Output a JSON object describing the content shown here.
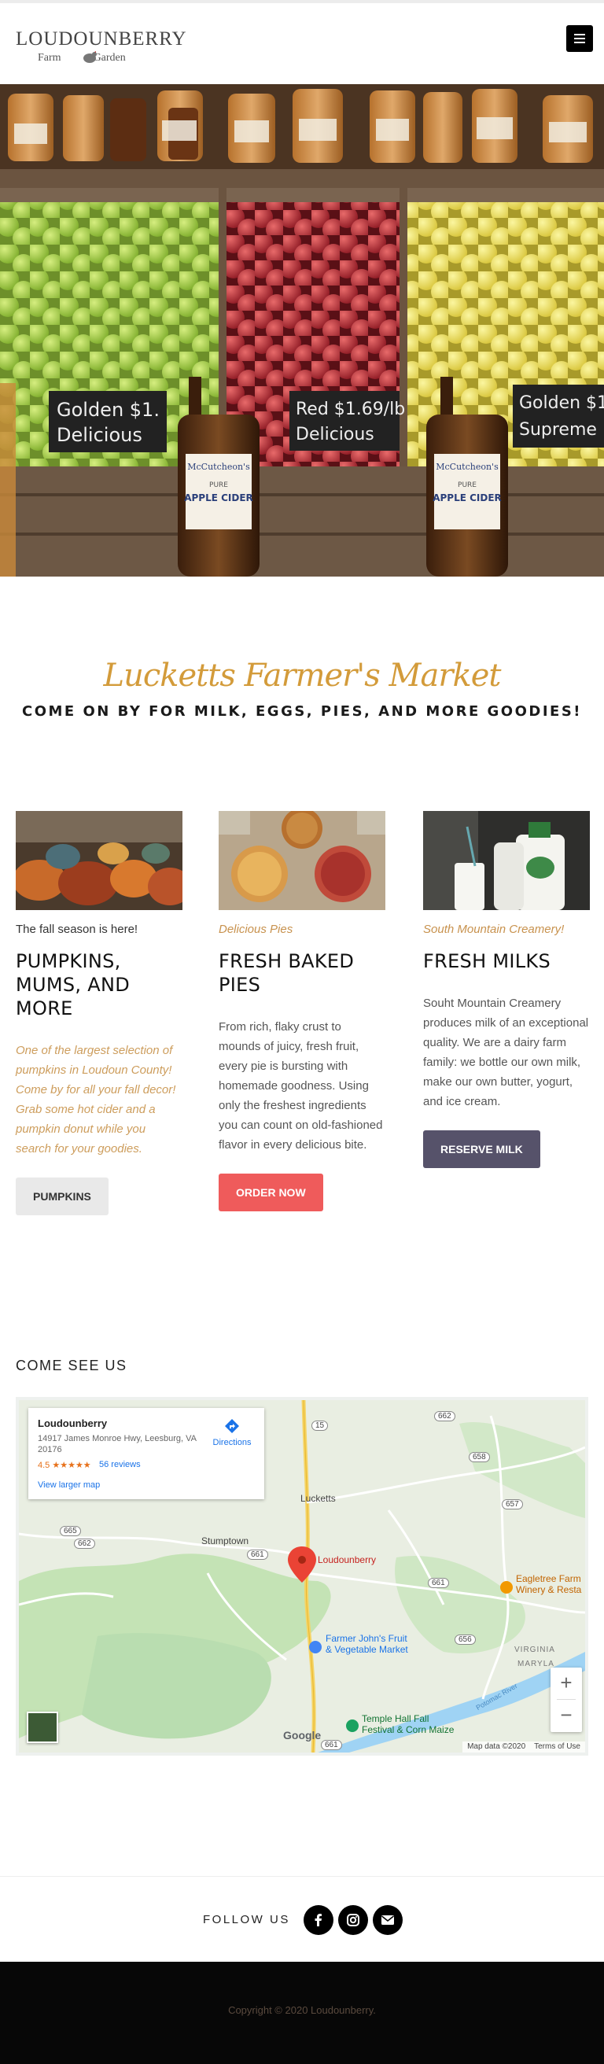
{
  "brand": {
    "name": "LOUDOUNBERRY",
    "tagline_left": "Farm",
    "tagline_right": "Garden",
    "menu_icon": "hamburger-icon"
  },
  "hero": {
    "signs": [
      {
        "line1": "Golden $1.",
        "line2": "Delicious"
      },
      {
        "line1": "Red $1.69/lb",
        "line2": "Delicious"
      },
      {
        "line1": "Golden $1.",
        "line2": "Supreme"
      }
    ],
    "bottle_brand": "McCutcheon's",
    "bottle_label": "APPLE CIDER",
    "bottle_label_top": "PURE"
  },
  "intro": {
    "title": "Lucketts Farmer's Market",
    "subtitle": "COME ON BY FOR MILK, EGGS, PIES, AND MORE GOODIES!"
  },
  "columns": [
    {
      "kicker": "The fall season is here!",
      "heading": "PUMPKINS, MUMS, AND MORE",
      "text": "One of the largest selection of pumpkins in Loudoun County! Come by for all your fall decor! Grab some hot cider and a pumpkin donut while you search for your goodies.",
      "button": "PUMPKINS"
    },
    {
      "kicker": "Delicious Pies",
      "heading": "FRESH BAKED PIES",
      "text": "From rich, flaky crust to mounds of juicy, fresh fruit, every pie is bursting with homemade goodness. Using only the freshest ingredients you can count on old-fashioned flavor in every delicious bite.",
      "button": "ORDER NOW"
    },
    {
      "kicker": "South Mountain Creamery!",
      "heading": "FRESH MILKS",
      "text": "Souht Mountain Creamery produces milk of an exceptional quality. We are a dairy farm family: we bottle our own milk, make our own butter, yogurt, and ice cream.",
      "button": "RESERVE MILK"
    }
  ],
  "map_section": {
    "heading": "COME SEE US",
    "card": {
      "name": "Loudounberry",
      "address": "14917 James Monroe Hwy, Leesburg, VA 20176",
      "rating": "4.5",
      "stars": "★★★★★",
      "reviews": "56 reviews",
      "larger_map": "View larger map",
      "directions": "Directions"
    },
    "labels": {
      "lucketts": "Lucketts",
      "stumptown": "Stumptown",
      "loudounberry": "Loudounberry",
      "farmer_john_1": "Farmer John's Fruit",
      "farmer_john_2": "& Vegetable Market",
      "eagletree_1": "Eagletree Farm",
      "eagletree_2": "Winery & Resta",
      "temple_1": "Temple Hall Fall",
      "temple_2": "Festival & Corn Maize",
      "virginia": "VIRGINIA",
      "maryland": "MARYLA",
      "potomac": "Potomac River"
    },
    "roads": [
      "15",
      "662",
      "658",
      "657",
      "665",
      "662",
      "661",
      "661",
      "656",
      "661"
    ],
    "google": "Google",
    "map_data": "Map data ©2020",
    "terms": "Terms of Use",
    "zoom_in": "+",
    "zoom_out": "−"
  },
  "follow": {
    "label": "FOLLOW US",
    "icons": [
      "facebook-icon",
      "instagram-icon",
      "email-icon"
    ]
  },
  "footer": {
    "copyright": "Copyright © 2020 Loudounberry."
  },
  "colors": {
    "accent_gold": "#d39b3a",
    "button_red": "#ef5b5b",
    "button_dark": "#56526a",
    "footer_bg": "#070707"
  }
}
